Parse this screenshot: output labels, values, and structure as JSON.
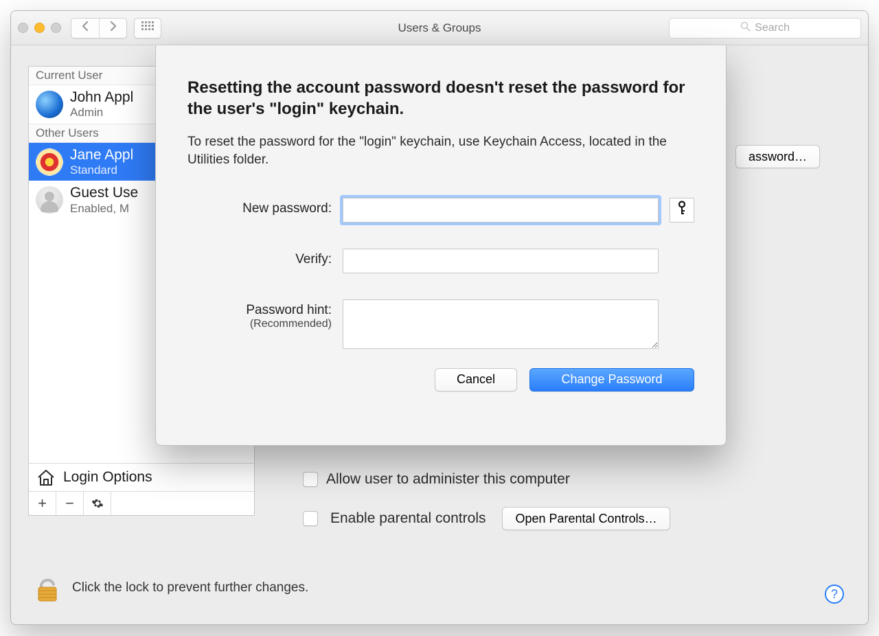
{
  "window": {
    "title": "Users & Groups"
  },
  "search": {
    "placeholder": "Search"
  },
  "sidebar": {
    "section_current": "Current User",
    "section_other": "Other Users",
    "login_options": "Login Options"
  },
  "users": [
    {
      "name": "John Appl",
      "sub": "Admin"
    },
    {
      "name": "Jane Appl",
      "sub": "Standard"
    },
    {
      "name": "Guest Use",
      "sub": "Enabled, M"
    }
  ],
  "detail": {
    "reset_button": "assword…",
    "admin_checkbox": "Allow user to administer this computer",
    "parental_checkbox": "Enable parental controls",
    "open_parental": "Open Parental Controls…"
  },
  "lock": {
    "text": "Click the lock to prevent further changes."
  },
  "sheet": {
    "heading": "Resetting the account password doesn't reset the password for the user's \"login\" keychain.",
    "desc": "To reset the password for the \"login\" keychain, use Keychain Access, located in the Utilities folder.",
    "new_password_label": "New password:",
    "verify_label": "Verify:",
    "hint_label": "Password hint:",
    "hint_sub": "(Recommended)",
    "cancel": "Cancel",
    "change": "Change Password"
  }
}
